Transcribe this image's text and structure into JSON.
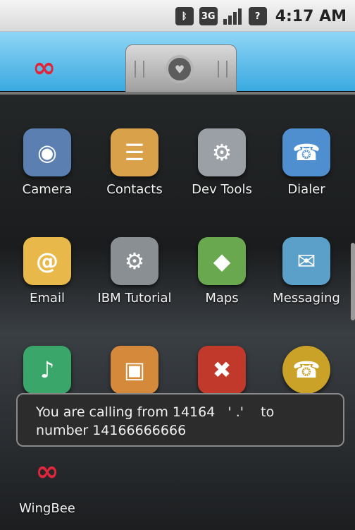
{
  "status_bar": {
    "bluetooth_icon": "bluetooth-icon",
    "network_label": "3G",
    "signal_icon": "signal-bars-icon",
    "help_icon_glyph": "?",
    "time": "4:17 AM"
  },
  "home": {
    "wingbee_glyph": "∞",
    "handle_icon": "drawer-handle-icon",
    "handle_glyph": "♥"
  },
  "apps": [
    {
      "label": "Camera",
      "glyph": "◉",
      "color": "#5a7fb0",
      "icon": "camera-icon"
    },
    {
      "label": "Contacts",
      "glyph": "☰",
      "color": "#d9a24a",
      "icon": "contacts-icon"
    },
    {
      "label": "Dev Tools",
      "glyph": "⚙",
      "color": "#9aa0a6",
      "icon": "gear-icon"
    },
    {
      "label": "Dialer",
      "glyph": "☎",
      "color": "#4f8fd0",
      "icon": "phone-icon"
    },
    {
      "label": "Email",
      "glyph": "@",
      "color": "#e9b84a",
      "icon": "email-icon"
    },
    {
      "label": "IBM Tutorial",
      "glyph": "⚙",
      "color": "#8a8f93",
      "icon": "tutorial-icon"
    },
    {
      "label": "Maps",
      "glyph": "◆",
      "color": "#6aa84f",
      "icon": "maps-icon"
    },
    {
      "label": "Messaging",
      "glyph": "✉",
      "color": "#5aa0c8",
      "icon": "messaging-icon"
    },
    {
      "label": "",
      "glyph": "♪",
      "color": "#3aa66a",
      "icon": "music-icon"
    },
    {
      "label": "",
      "glyph": "▣",
      "color": "#d48a3a",
      "icon": "gallery-icon"
    },
    {
      "label": "",
      "glyph": "✖",
      "color": "#c0392b",
      "icon": "settings-tools-icon"
    },
    {
      "label": "",
      "glyph": "☎",
      "color": "#c9a227",
      "icon": "phone-gold-icon"
    },
    {
      "label": "WingBee",
      "glyph": "∞",
      "color": "#1f2224",
      "icon": "wingbee-icon"
    }
  ],
  "toast": {
    "line1": "You are calling from 14164   ' .'    to",
    "line2": "number 14166666666"
  }
}
